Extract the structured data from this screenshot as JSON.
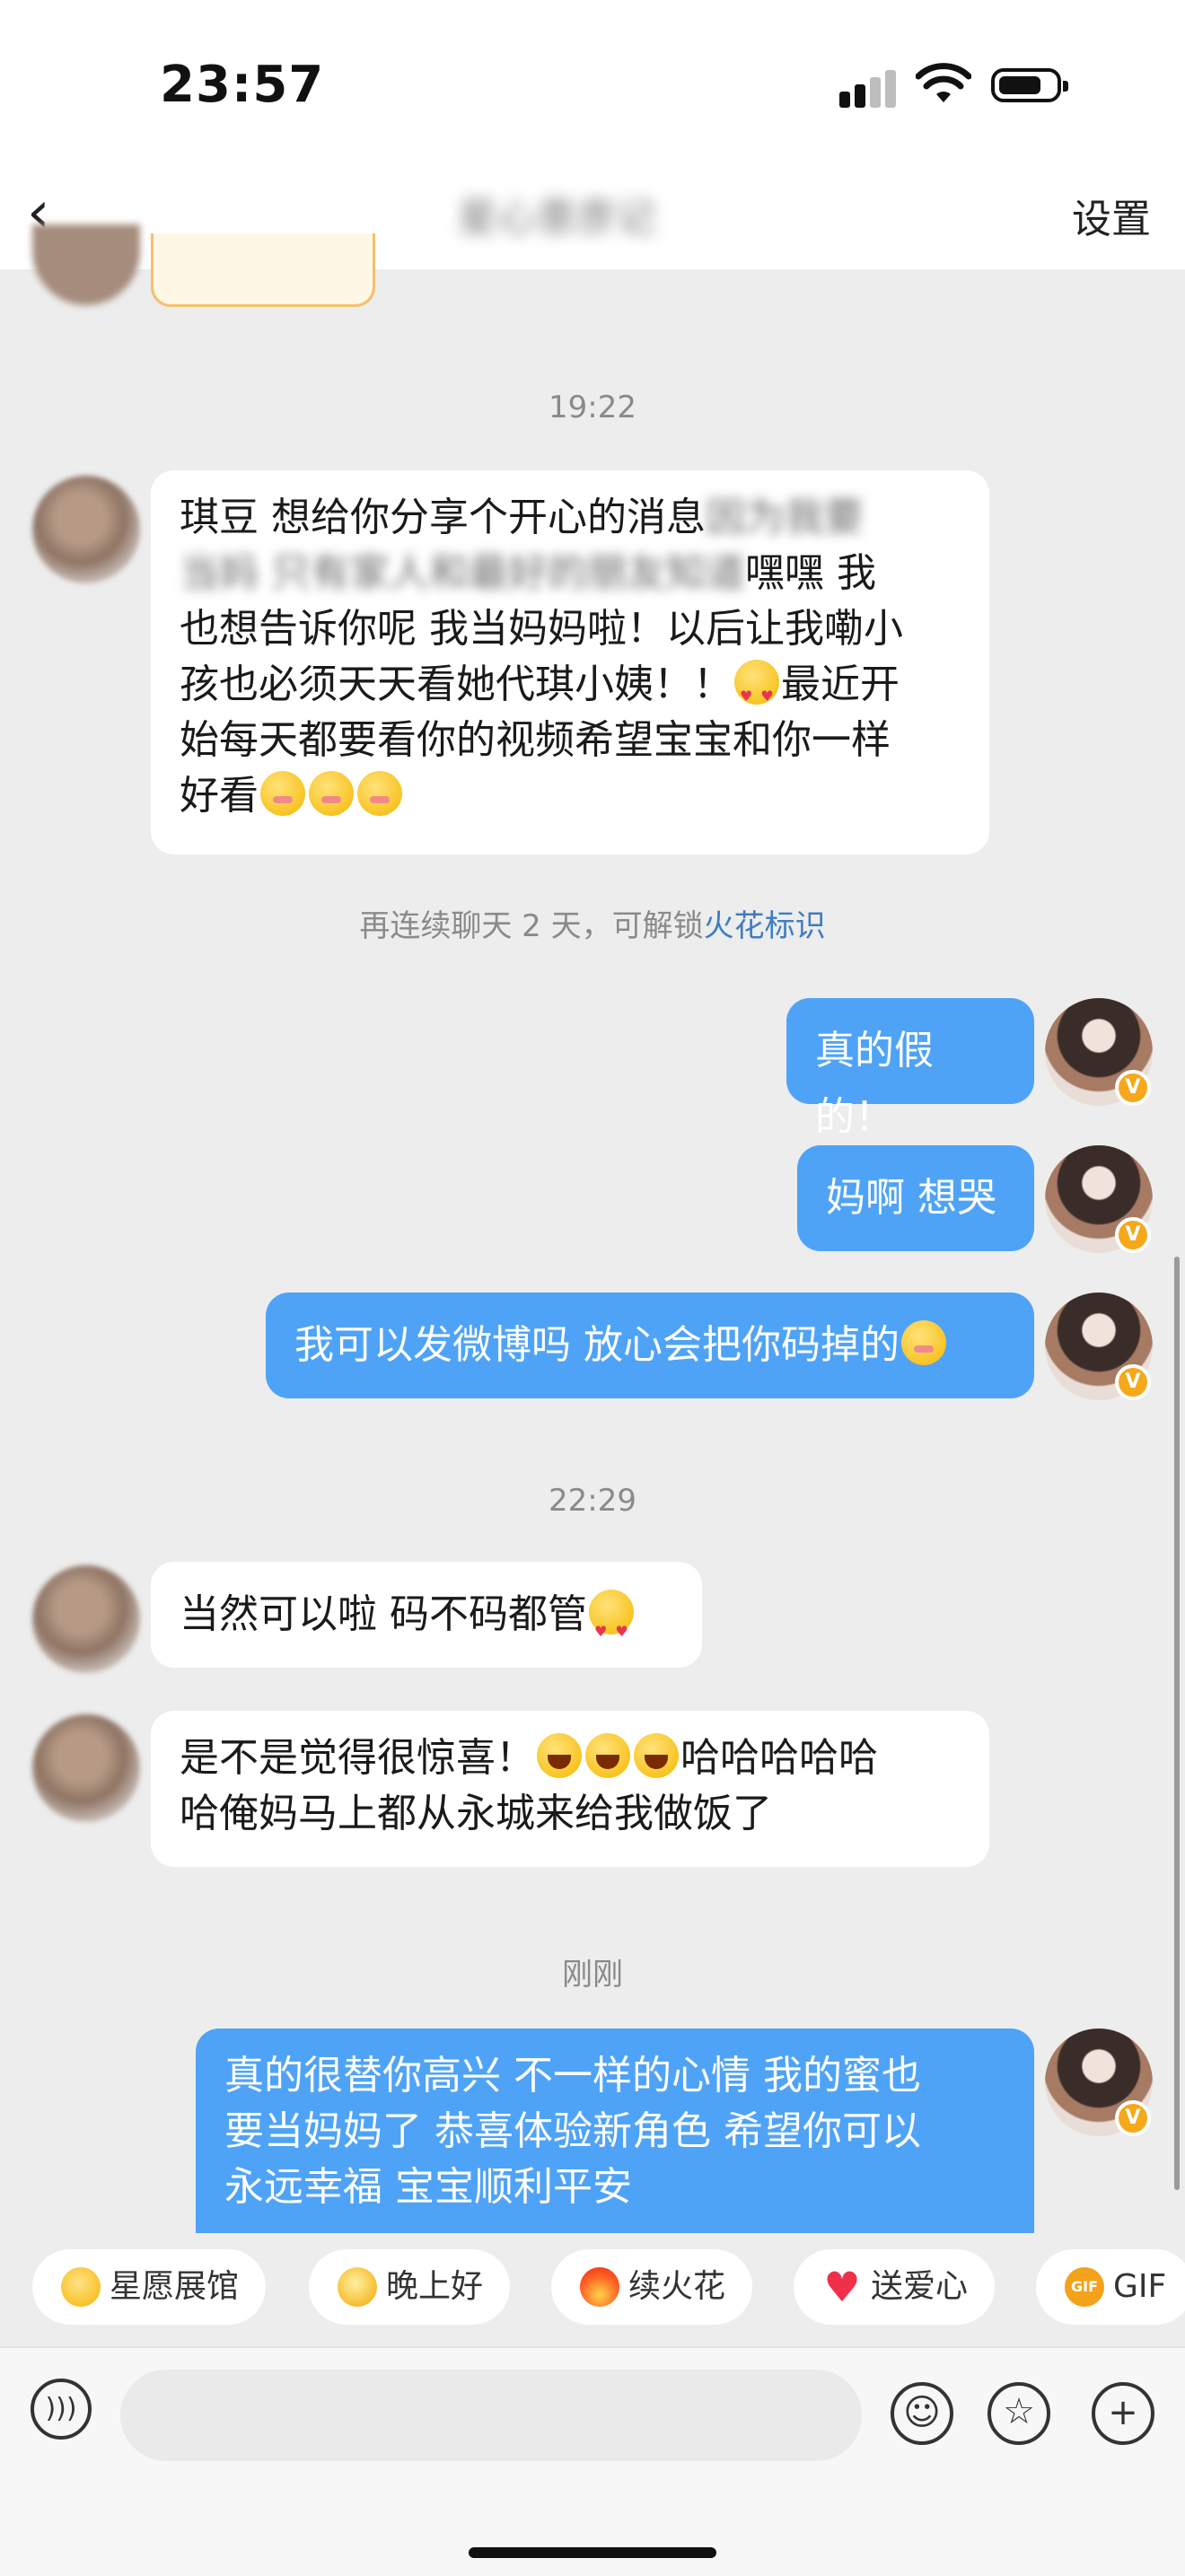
{
  "status_bar": {
    "time": "23:57"
  },
  "header": {
    "title": "星心意彦记",
    "settings_label": "设置",
    "back_icon": "chevron-left-icon"
  },
  "messages": {
    "ts1": "19:22",
    "m1_line1": "琪豆 想给你分享个开心的消息",
    "m1_blur1": "因为我要",
    "m1_blur2": "当妈 只有家人和最好的朋友知道",
    "m1_line2_tail": "嘿嘿 我",
    "m1_line3": "也想告诉你呢 我当妈妈啦！以后让我嘞小",
    "m1_line4a": "孩也必须天天看她代琪小姨！！",
    "m1_line4b": "最近开",
    "m1_line5": "始每天都要看你的视频希望宝宝和你一样",
    "m1_line6": "好看",
    "hint_text": "再连续聊天 2 天，可解锁",
    "hint_link": "火花标识",
    "m2": "真的假的！",
    "m3": "妈啊 想哭",
    "m4": "我可以发微博吗 放心会把你码掉的",
    "ts2": "22:29",
    "m5": "当然可以啦 码不码都管",
    "m6_line1a": "是不是觉得很惊喜！",
    "m6_line1b": "哈哈哈哈哈",
    "m6_line2": "哈俺妈马上都从永城来给我做饭了",
    "ts3": "刚刚",
    "m7_line1": "真的很替你高兴 不一样的心情 我的蜜也",
    "m7_line2": "要当妈妈了 恭喜体验新角色 希望你可以",
    "m7_line3": "永远幸福 宝宝顺利平安"
  },
  "quick_actions": [
    {
      "label": "星愿展馆",
      "icon": "star-icon"
    },
    {
      "label": "晚上好",
      "icon": "star-face-icon"
    },
    {
      "label": "续火花",
      "icon": "flame-icon"
    },
    {
      "label": "送爱心",
      "icon": "heart-icon"
    },
    {
      "label": "GIF",
      "icon": "gif-icon"
    }
  ],
  "colors": {
    "outgoing_bubble": "#4fa3f7",
    "incoming_bubble": "#ffffff",
    "link": "#3f7cc4",
    "verified_badge": "#f6a81b"
  }
}
